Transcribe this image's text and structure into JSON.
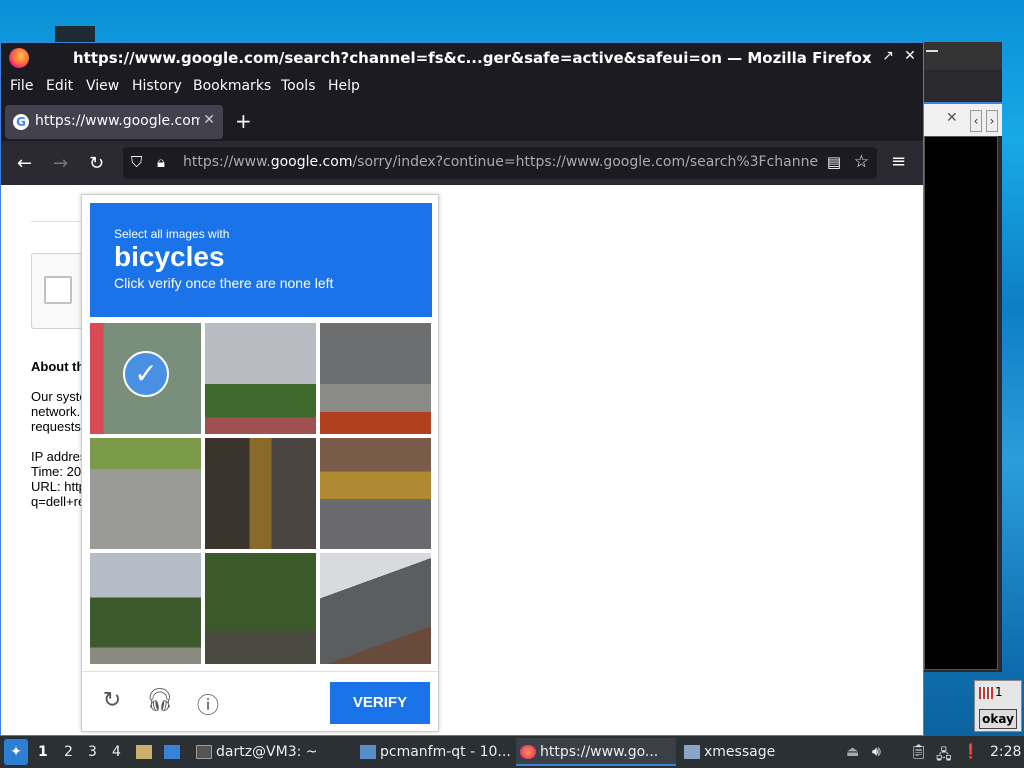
{
  "firefox": {
    "title": "https://www.google.com/search?channel=fs&c...ger&safe=active&safeui=on — Mozilla Firefox",
    "window_buttons": [
      "–",
      "↗",
      "✕"
    ],
    "menu": [
      "File",
      "Edit",
      "View",
      "History",
      "Bookmarks",
      "Tools",
      "Help"
    ],
    "tab_title": "https://www.google.com/",
    "url_prefix": "https://www.",
    "url_domain": "google.com",
    "url_rest": "/sorry/index?continue=https://www.google.com/search%3Fchanne"
  },
  "page": {
    "about": "About th",
    "lines": [
      "Our syste",
      "network.",
      "requests",
      "IP addres",
      "Time: 20",
      "URL: http",
      "q=dell+re"
    ]
  },
  "captcha": {
    "instruction": "Select all images with",
    "target": "bicycles",
    "sub": "Click verify once there are none left",
    "verify_label": "VERIFY",
    "selected_tiles": [
      0
    ]
  },
  "xmessage": {
    "count": "1",
    "ok_label": "okay"
  },
  "taskbar": {
    "workspaces": [
      "1",
      "2",
      "3",
      "4"
    ],
    "tasks": [
      "dartz@VM3: ~",
      "pcmanfm-qt - 10...",
      "https://www.go...",
      "xmessage"
    ],
    "clock": "2:28"
  }
}
